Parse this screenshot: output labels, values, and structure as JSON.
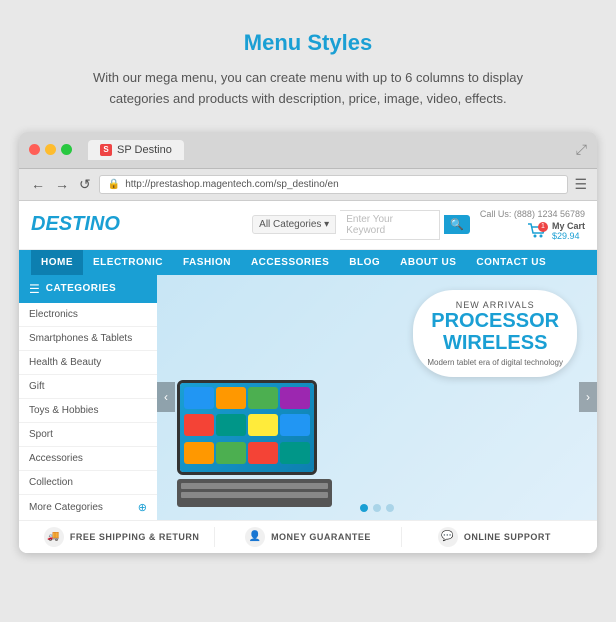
{
  "heading": {
    "highlight": "Menu",
    "rest": " Styles"
  },
  "subtext": "With our mega menu, you can create menu with up to 6 columns to display categories and products with description, price, image, video, effects.",
  "browser": {
    "tab_title": "SP Destino",
    "address": "http://prestashop.magentech.com/sp_destino/en"
  },
  "site": {
    "logo": "DESTINO",
    "search_placeholder": "Enter Your Keyword",
    "category_label": "All Categories ▾",
    "call_label": "Call Us: (888) 1234 56789",
    "cart_label": "My Cart",
    "cart_amount": "$29.94",
    "nav_items": [
      "HOME",
      "ELECTRONIC",
      "FASHION",
      "ACCESSORIES",
      "BLOG",
      "ABOUT US",
      "CONTACT US"
    ],
    "active_nav": "HOME",
    "sidebar_header": "CATEGORIES",
    "sidebar_items": [
      "Electronics",
      "Smartphones & Tablets",
      "Health & Beauty",
      "Gift",
      "Toys & Hobbies",
      "Sport",
      "Accessories",
      "Collection"
    ],
    "sidebar_more": "More Categories",
    "hero_badge": "NEW ARRIVALS",
    "hero_title_line1": "PROCESSOR",
    "hero_title_line2": "WIRELESS",
    "hero_desc": "Modern tablet era of digital technology",
    "footer_items": [
      "FREE SHIPPING & RETURN",
      "MONEY GUARANTEE",
      "ONLINE SUPPORT"
    ]
  }
}
